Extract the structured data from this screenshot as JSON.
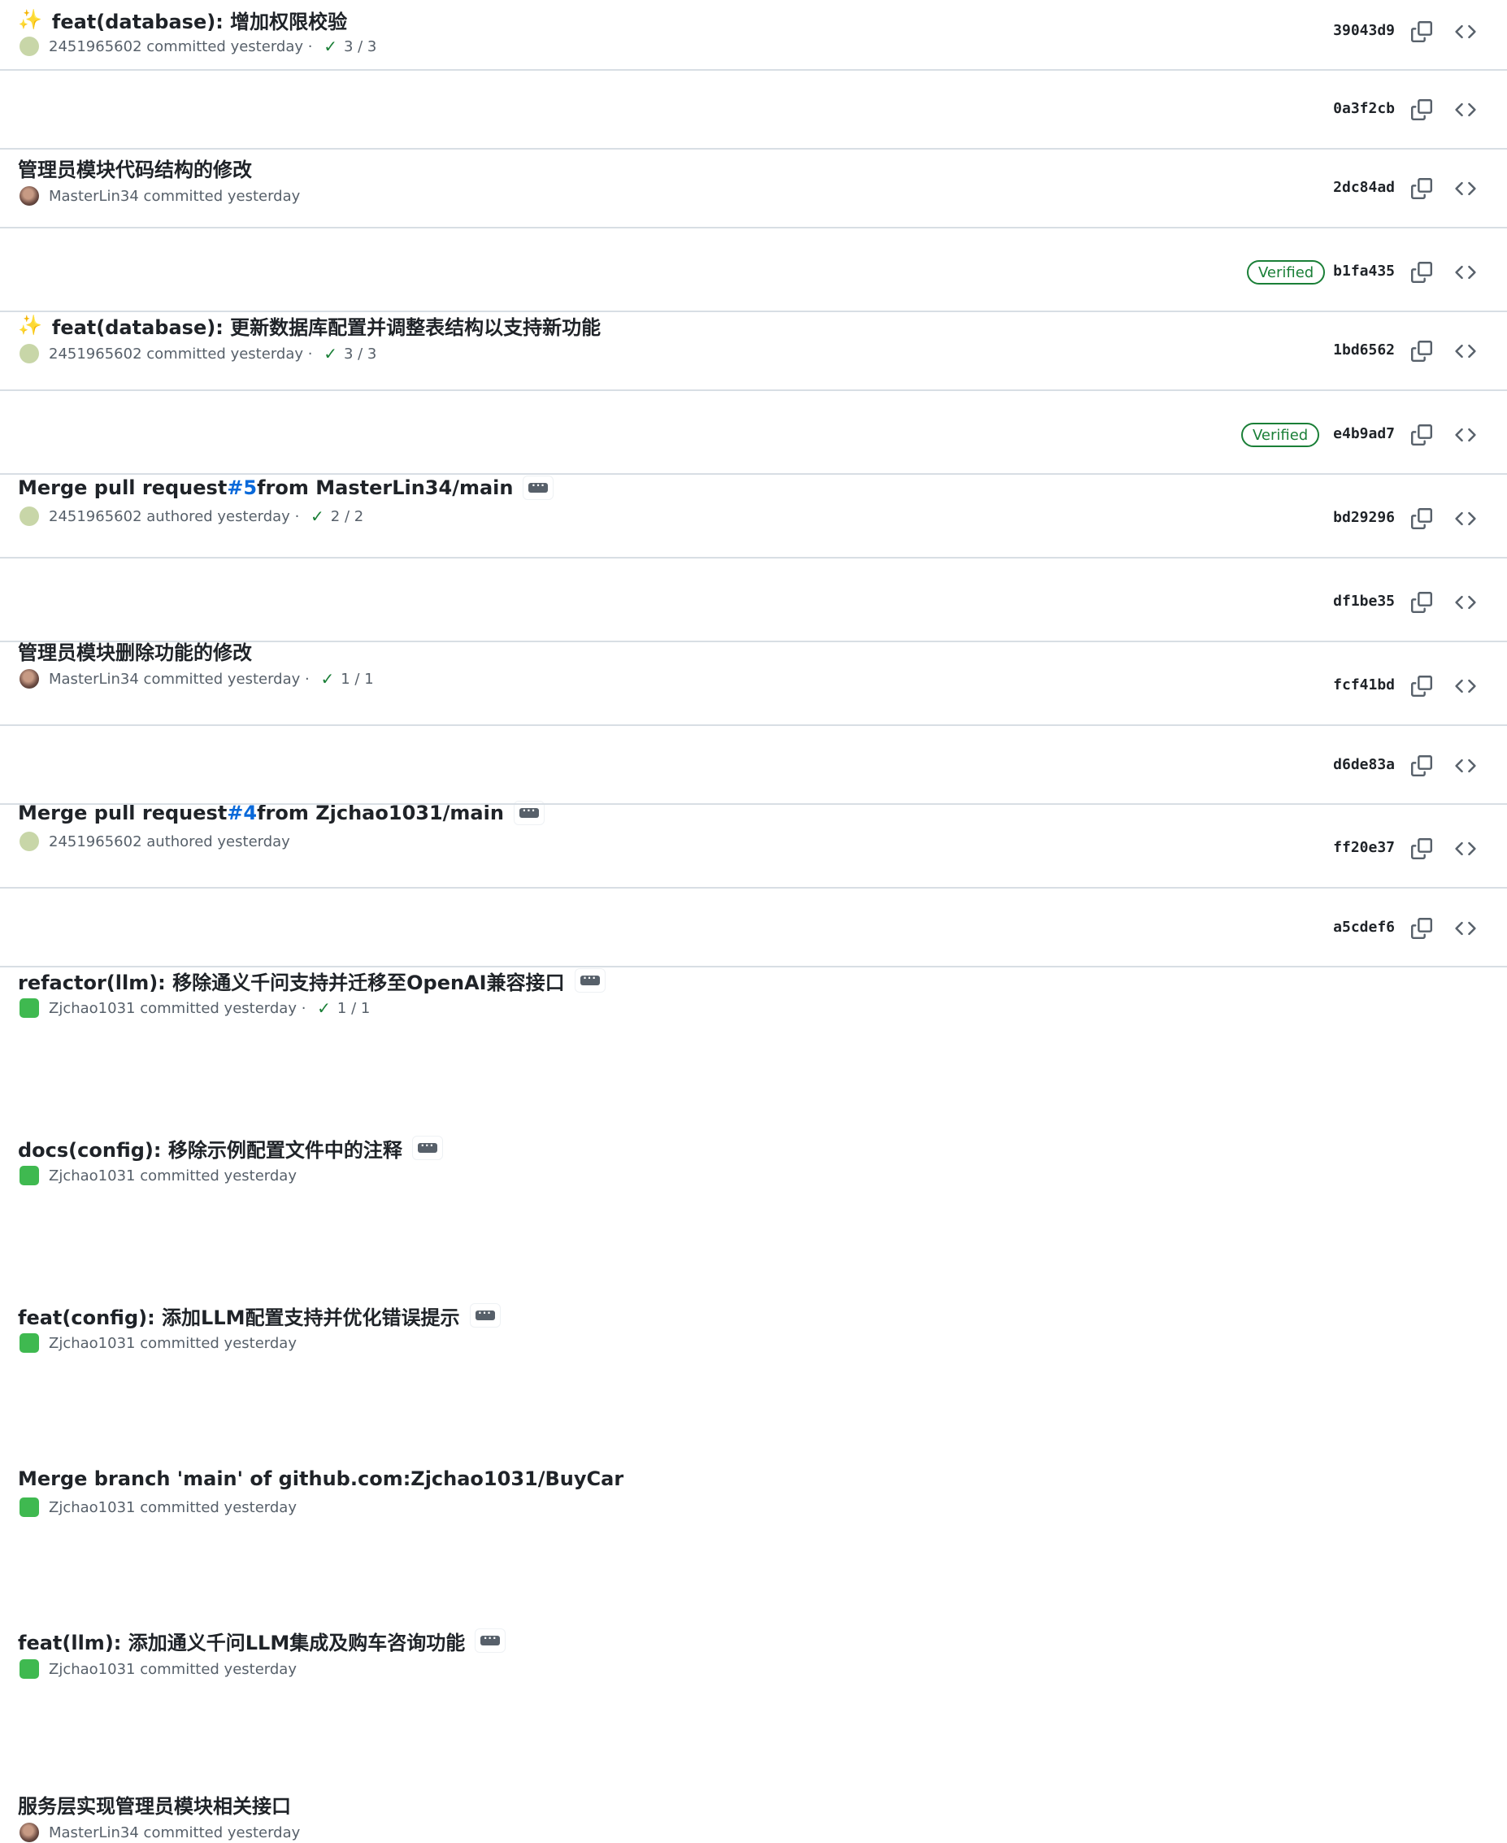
{
  "commits": [
    {
      "emoji": "✨",
      "title": "feat(database): 增加权限校验",
      "author": "2451965602",
      "action": "committed yesterday",
      "checks": "3 / 3",
      "sha": "39043d9",
      "verified": false,
      "avatar": "tan"
    },
    {
      "emoji": "",
      "title": "管理员模块代码结构的修改",
      "author": "MasterLin34",
      "action": "committed yesterday",
      "checks": "",
      "sha": "0a3f2cb",
      "verified": false,
      "avatar": "photo"
    },
    {
      "emoji": "✨",
      "title": "feat(database): 更新数据库配置并调整表结构以支持新功能",
      "author": "2451965602",
      "action": "committed yesterday",
      "checks": "3 / 3",
      "sha": "2dc84ad",
      "verified": false,
      "avatar": "tan"
    },
    {
      "emoji": "",
      "title_pre": "Merge pull request ",
      "pr": "#5",
      "title_post": " from MasterLin34/main",
      "author": "2451965602",
      "action": "authored yesterday",
      "checks": "2 / 2",
      "sha": "b1fa435",
      "verified": true,
      "verified_label": "Verified",
      "avatar": "tan",
      "ellipsis": true
    },
    {
      "emoji": "",
      "title": "管理员模块删除功能的修改",
      "author": "MasterLin34",
      "action": "committed yesterday",
      "checks": "1 / 1",
      "sha": "1bd6562",
      "verified": false,
      "avatar": "photo"
    },
    {
      "emoji": "",
      "title_pre": "Merge pull request ",
      "pr": "#4",
      "title_post": " from Zjchao1031/main",
      "author": "2451965602",
      "action": "authored yesterday",
      "checks": "",
      "sha": "e4b9ad7",
      "verified": true,
      "verified_label": "Verified",
      "avatar": "tan",
      "ellipsis": true
    },
    {
      "emoji": "",
      "title": "refactor(llm): 移除通义千问支持并迁移至OpenAI兼容接口",
      "author": "Zjchao1031",
      "action": "committed yesterday",
      "checks": "1 / 1",
      "sha": "bd29296",
      "verified": false,
      "avatar": "green",
      "ellipsis": true
    },
    {
      "emoji": "",
      "title": "docs(config): 移除示例配置文件中的注释",
      "author": "Zjchao1031",
      "action": "committed yesterday",
      "checks": "",
      "sha": "df1be35",
      "verified": false,
      "avatar": "green",
      "ellipsis": true
    },
    {
      "emoji": "",
      "title": "feat(config): 添加LLM配置支持并优化错误提示",
      "author": "Zjchao1031",
      "action": "committed yesterday",
      "checks": "",
      "sha": "fcf41bd",
      "verified": false,
      "avatar": "green",
      "ellipsis": true
    },
    {
      "emoji": "",
      "title": "Merge branch 'main' of github.com:Zjchao1031/BuyCar",
      "author": "Zjchao1031",
      "action": "committed yesterday",
      "checks": "",
      "sha": "d6de83a",
      "verified": false,
      "avatar": "green"
    },
    {
      "emoji": "",
      "title": "feat(llm): 添加通义千问LLM集成及购车咨询功能",
      "author": "Zjchao1031",
      "action": "committed yesterday",
      "checks": "",
      "sha": "ff20e37",
      "verified": false,
      "avatar": "green",
      "ellipsis": true
    },
    {
      "emoji": "",
      "title": "服务层实现管理员模块相关接口",
      "author": "MasterLin34",
      "action": "committed yesterday",
      "checks": "",
      "sha": "a5cdef6",
      "verified": false,
      "avatar": "photo"
    }
  ],
  "separator": " · ",
  "check_icon": "✓",
  "colors": {
    "link": "#0969da",
    "verified": "#1a7f37",
    "muted": "#57606a",
    "border": "#d8dee4"
  }
}
